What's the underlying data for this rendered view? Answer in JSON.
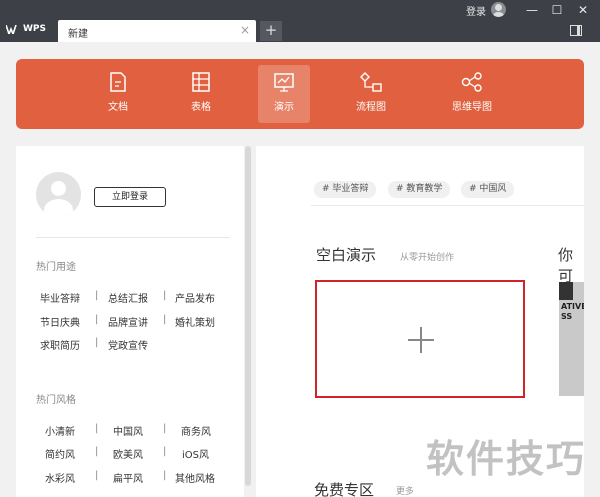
{
  "titlebar": {
    "app_logo": "WPS",
    "tab_title": "新建",
    "tab_close": "×",
    "add_tab": "+",
    "login_label": "登录",
    "minimize": "—",
    "maximize": "☐",
    "close": "✕"
  },
  "typebar": {
    "items": [
      {
        "label": "文档",
        "icon": "document-icon"
      },
      {
        "label": "表格",
        "icon": "spreadsheet-icon"
      },
      {
        "label": "演示",
        "icon": "presentation-icon",
        "active": true
      },
      {
        "label": "流程图",
        "icon": "flowchart-icon"
      },
      {
        "label": "思维导图",
        "icon": "mindmap-icon"
      }
    ],
    "color": "#e0603f"
  },
  "left": {
    "login_button": "立即登录",
    "usage_title": "热门用途",
    "usage_rows": [
      [
        "毕业答辩",
        "总结汇报",
        "产品发布"
      ],
      [
        "节日庆典",
        "品牌宣讲",
        "婚礼策划"
      ],
      [
        "求职简历",
        "党政宣传"
      ]
    ],
    "style_title": "热门风格",
    "style_rows": [
      [
        "小清新",
        "中国风",
        "商务风"
      ],
      [
        "简约风",
        "欧美风",
        "iOS风"
      ],
      [
        "水彩风",
        "扁平风",
        "其他风格"
      ]
    ],
    "separator": "|"
  },
  "right": {
    "tags": [
      "# 毕业答辩",
      "# 教育教学",
      "# 中国风"
    ],
    "blank_title": "空白演示",
    "blank_subtitle": "从零开始创作",
    "plus": "+",
    "next_title": "你可",
    "thumb_text": "ATIVE\nSS",
    "free_title": "免费专区",
    "free_more": "更多"
  },
  "watermark": "软件技巧",
  "colors": {
    "titlebar": "#3d4147",
    "accent": "#e0603f",
    "highlight_border": "#d0242a"
  }
}
